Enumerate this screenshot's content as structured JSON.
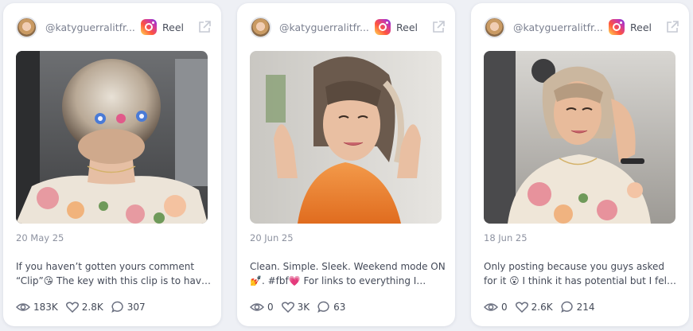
{
  "posts": [
    {
      "handle": "@katyguerralitfr...",
      "type": "Reel",
      "date": "20 May 25",
      "caption": "If you haven’t gotten yours comment “Clip”😘 The key with this clip is to have ...",
      "views": "183K",
      "likes": "2.8K",
      "comments": "307"
    },
    {
      "handle": "@katyguerralitfr...",
      "type": "Reel",
      "date": "20 Jun 25",
      "caption": "Clean. Simple. Sleek. Weekend mode ON 💅. #fbf💗 For links to everything I used...",
      "views": "0",
      "likes": "3K",
      "comments": "63"
    },
    {
      "handle": "@katyguerralitfr...",
      "type": "Reel",
      "date": "18 Jun 25",
      "caption": "Only posting because you guys asked for it 😮 I think it has potential but I felt a bit...",
      "views": "0",
      "likes": "2.6K",
      "comments": "214"
    }
  ],
  "icons": {
    "platform": "instagram-icon",
    "open": "external-link-icon",
    "views": "eye-icon",
    "likes": "heart-icon",
    "comments": "comment-icon"
  }
}
